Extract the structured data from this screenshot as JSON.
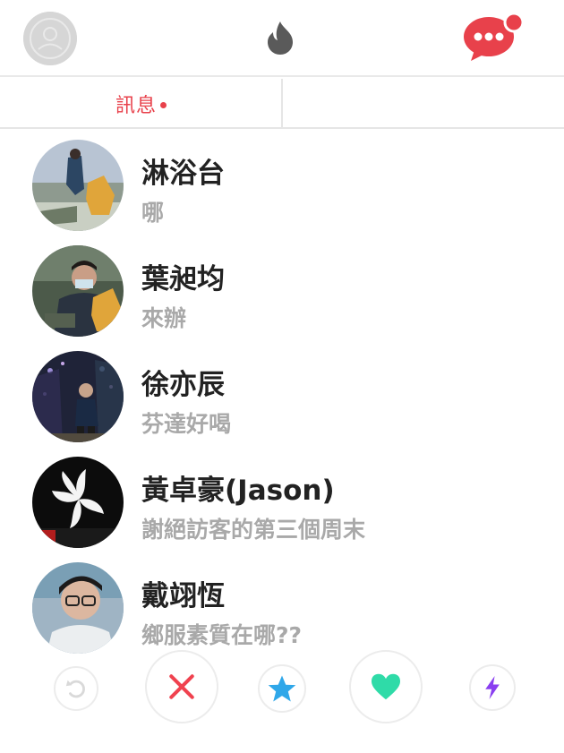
{
  "header": {
    "profile_icon": "user-silhouette-icon",
    "logo_icon": "flame-icon",
    "messages_icon": "chat-bubble-icon",
    "accent_color": "#e8414b"
  },
  "tabs": {
    "messages_label": "訊息"
  },
  "messages": [
    {
      "name": "淋浴台",
      "preview": "哪"
    },
    {
      "name": "葉昶均",
      "preview": "來辦"
    },
    {
      "name": "徐亦辰",
      "preview": "芬達好喝"
    },
    {
      "name": "黃卓豪(Jason)",
      "preview": "謝絕訪客的第三個周末"
    },
    {
      "name": "戴翊恆",
      "preview": "鄉服素質在哪??"
    }
  ],
  "actions": {
    "rewind_icon": "rewind-icon",
    "nope_icon": "x-icon",
    "nope_color": "#f0424f",
    "superlike_icon": "star-icon",
    "superlike_color": "#2fa7e9",
    "like_icon": "heart-icon",
    "like_color": "#2fdba8",
    "boost_icon": "lightning-icon",
    "boost_color": "#8a3ff0"
  }
}
